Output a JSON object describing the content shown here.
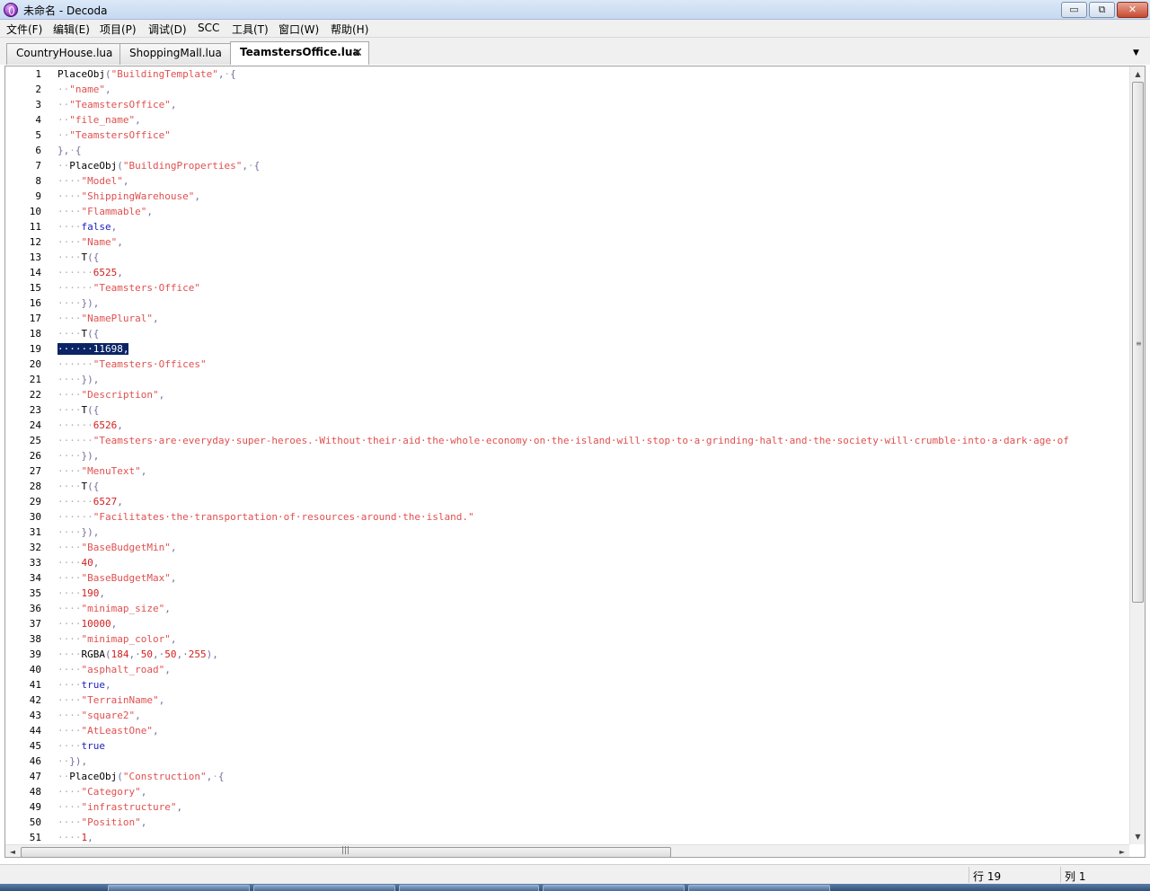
{
  "window": {
    "title": "未命名 - Decoda",
    "minimize_label": "▭",
    "maximize_label": "⧉",
    "close_label": "✕"
  },
  "menu": [
    {
      "label": "文件(F)"
    },
    {
      "label": "编辑(E)"
    },
    {
      "label": "项目(P)"
    },
    {
      "label": "调试(D)"
    },
    {
      "label": "SCC"
    },
    {
      "label": "工具(T)"
    },
    {
      "label": "窗口(W)"
    },
    {
      "label": "帮助(H)"
    }
  ],
  "tabs": [
    {
      "label": "CountryHouse.lua",
      "active": false
    },
    {
      "label": "ShoppingMall.lua",
      "active": false
    },
    {
      "label": "TeamstersOffice.lua",
      "active": true
    }
  ],
  "tab_close_label": "✕",
  "editor": {
    "selected_line": 19,
    "lines": [
      {
        "n": "1",
        "tokens": [
          [
            "PlaceObj",
            "d"
          ],
          [
            "(",
            "p"
          ],
          [
            "\"BuildingTemplate\"",
            "s"
          ],
          [
            ",",
            "p"
          ],
          [
            "·",
            "w"
          ],
          [
            "{",
            "p"
          ]
        ]
      },
      {
        "n": "2",
        "tokens": [
          [
            "··",
            "w"
          ],
          [
            "\"name\"",
            "s"
          ],
          [
            ",",
            "p"
          ]
        ]
      },
      {
        "n": "3",
        "tokens": [
          [
            "··",
            "w"
          ],
          [
            "\"TeamstersOffice\"",
            "s"
          ],
          [
            ",",
            "p"
          ]
        ]
      },
      {
        "n": "4",
        "tokens": [
          [
            "··",
            "w"
          ],
          [
            "\"file_name\"",
            "s"
          ],
          [
            ",",
            "p"
          ]
        ]
      },
      {
        "n": "5",
        "tokens": [
          [
            "··",
            "w"
          ],
          [
            "\"TeamstersOffice\"",
            "s"
          ]
        ]
      },
      {
        "n": "6",
        "tokens": [
          [
            "},",
            "p"
          ],
          [
            "·",
            "w"
          ],
          [
            "{",
            "p"
          ]
        ]
      },
      {
        "n": "7",
        "tokens": [
          [
            "··",
            "w"
          ],
          [
            "PlaceObj",
            "d"
          ],
          [
            "(",
            "p"
          ],
          [
            "\"BuildingProperties\"",
            "s"
          ],
          [
            ",",
            "p"
          ],
          [
            "·",
            "w"
          ],
          [
            "{",
            "p"
          ]
        ]
      },
      {
        "n": "8",
        "tokens": [
          [
            "····",
            "w"
          ],
          [
            "\"Model\"",
            "s"
          ],
          [
            ",",
            "p"
          ]
        ]
      },
      {
        "n": "9",
        "tokens": [
          [
            "····",
            "w"
          ],
          [
            "\"ShippingWarehouse\"",
            "s"
          ],
          [
            ",",
            "p"
          ]
        ]
      },
      {
        "n": "10",
        "tokens": [
          [
            "····",
            "w"
          ],
          [
            "\"Flammable\"",
            "s"
          ],
          [
            ",",
            "p"
          ]
        ]
      },
      {
        "n": "11",
        "tokens": [
          [
            "····",
            "w"
          ],
          [
            "false",
            "k"
          ],
          [
            ",",
            "p"
          ]
        ]
      },
      {
        "n": "12",
        "tokens": [
          [
            "····",
            "w"
          ],
          [
            "\"Name\"",
            "s"
          ],
          [
            ",",
            "p"
          ]
        ]
      },
      {
        "n": "13",
        "tokens": [
          [
            "····",
            "w"
          ],
          [
            "T",
            "d"
          ],
          [
            "({",
            "p"
          ]
        ]
      },
      {
        "n": "14",
        "tokens": [
          [
            "······",
            "w"
          ],
          [
            "6525",
            "n"
          ],
          [
            ",",
            "p"
          ]
        ]
      },
      {
        "n": "15",
        "tokens": [
          [
            "······",
            "w"
          ],
          [
            "\"Teamsters·Office\"",
            "s"
          ]
        ]
      },
      {
        "n": "16",
        "tokens": [
          [
            "····",
            "w"
          ],
          [
            "}),",
            "p"
          ]
        ]
      },
      {
        "n": "17",
        "tokens": [
          [
            "····",
            "w"
          ],
          [
            "\"NamePlural\"",
            "s"
          ],
          [
            ",",
            "p"
          ]
        ]
      },
      {
        "n": "18",
        "tokens": [
          [
            "····",
            "w"
          ],
          [
            "T",
            "d"
          ],
          [
            "({",
            "p"
          ]
        ]
      },
      {
        "n": "19",
        "tokens": [
          [
            "······11698,",
            "sel"
          ]
        ]
      },
      {
        "n": "20",
        "tokens": [
          [
            "······",
            "w"
          ],
          [
            "\"Teamsters·Offices\"",
            "s"
          ]
        ]
      },
      {
        "n": "21",
        "tokens": [
          [
            "····",
            "w"
          ],
          [
            "}),",
            "p"
          ]
        ]
      },
      {
        "n": "22",
        "tokens": [
          [
            "····",
            "w"
          ],
          [
            "\"Description\"",
            "s"
          ],
          [
            ",",
            "p"
          ]
        ]
      },
      {
        "n": "23",
        "tokens": [
          [
            "····",
            "w"
          ],
          [
            "T",
            "d"
          ],
          [
            "({",
            "p"
          ]
        ]
      },
      {
        "n": "24",
        "tokens": [
          [
            "······",
            "w"
          ],
          [
            "6526",
            "n"
          ],
          [
            ",",
            "p"
          ]
        ]
      },
      {
        "n": "25",
        "tokens": [
          [
            "······",
            "w"
          ],
          [
            "\"Teamsters·are·everyday·super-heroes.·Without·their·aid·the·whole·economy·on·the·island·will·stop·to·a·grinding·halt·and·the·society·will·crumble·into·a·dark·age·of",
            "s"
          ]
        ]
      },
      {
        "n": "26",
        "tokens": [
          [
            "····",
            "w"
          ],
          [
            "}),",
            "p"
          ]
        ]
      },
      {
        "n": "27",
        "tokens": [
          [
            "····",
            "w"
          ],
          [
            "\"MenuText\"",
            "s"
          ],
          [
            ",",
            "p"
          ]
        ]
      },
      {
        "n": "28",
        "tokens": [
          [
            "····",
            "w"
          ],
          [
            "T",
            "d"
          ],
          [
            "({",
            "p"
          ]
        ]
      },
      {
        "n": "29",
        "tokens": [
          [
            "······",
            "w"
          ],
          [
            "6527",
            "n"
          ],
          [
            ",",
            "p"
          ]
        ]
      },
      {
        "n": "30",
        "tokens": [
          [
            "······",
            "w"
          ],
          [
            "\"Facilitates·the·transportation·of·resources·around·the·island.\"",
            "s"
          ]
        ]
      },
      {
        "n": "31",
        "tokens": [
          [
            "····",
            "w"
          ],
          [
            "}),",
            "p"
          ]
        ]
      },
      {
        "n": "32",
        "tokens": [
          [
            "····",
            "w"
          ],
          [
            "\"BaseBudgetMin\"",
            "s"
          ],
          [
            ",",
            "p"
          ]
        ]
      },
      {
        "n": "33",
        "tokens": [
          [
            "····",
            "w"
          ],
          [
            "40",
            "n"
          ],
          [
            ",",
            "p"
          ]
        ]
      },
      {
        "n": "34",
        "tokens": [
          [
            "····",
            "w"
          ],
          [
            "\"BaseBudgetMax\"",
            "s"
          ],
          [
            ",",
            "p"
          ]
        ]
      },
      {
        "n": "35",
        "tokens": [
          [
            "····",
            "w"
          ],
          [
            "190",
            "n"
          ],
          [
            ",",
            "p"
          ]
        ]
      },
      {
        "n": "36",
        "tokens": [
          [
            "····",
            "w"
          ],
          [
            "\"minimap_size\"",
            "s"
          ],
          [
            ",",
            "p"
          ]
        ]
      },
      {
        "n": "37",
        "tokens": [
          [
            "····",
            "w"
          ],
          [
            "10000",
            "n"
          ],
          [
            ",",
            "p"
          ]
        ]
      },
      {
        "n": "38",
        "tokens": [
          [
            "····",
            "w"
          ],
          [
            "\"minimap_color\"",
            "s"
          ],
          [
            ",",
            "p"
          ]
        ]
      },
      {
        "n": "39",
        "tokens": [
          [
            "····",
            "w"
          ],
          [
            "RGBA",
            "d"
          ],
          [
            "(",
            "p"
          ],
          [
            "184",
            "n"
          ],
          [
            ",·",
            "p"
          ],
          [
            "50",
            "n"
          ],
          [
            ",·",
            "p"
          ],
          [
            "50",
            "n"
          ],
          [
            ",·",
            "p"
          ],
          [
            "255",
            "n"
          ],
          [
            "),",
            "p"
          ]
        ]
      },
      {
        "n": "40",
        "tokens": [
          [
            "····",
            "w"
          ],
          [
            "\"asphalt_road\"",
            "s"
          ],
          [
            ",",
            "p"
          ]
        ]
      },
      {
        "n": "41",
        "tokens": [
          [
            "····",
            "w"
          ],
          [
            "true",
            "k"
          ],
          [
            ",",
            "p"
          ]
        ]
      },
      {
        "n": "42",
        "tokens": [
          [
            "····",
            "w"
          ],
          [
            "\"TerrainName\"",
            "s"
          ],
          [
            ",",
            "p"
          ]
        ]
      },
      {
        "n": "43",
        "tokens": [
          [
            "····",
            "w"
          ],
          [
            "\"square2\"",
            "s"
          ],
          [
            ",",
            "p"
          ]
        ]
      },
      {
        "n": "44",
        "tokens": [
          [
            "····",
            "w"
          ],
          [
            "\"AtLeastOne\"",
            "s"
          ],
          [
            ",",
            "p"
          ]
        ]
      },
      {
        "n": "45",
        "tokens": [
          [
            "····",
            "w"
          ],
          [
            "true",
            "k"
          ]
        ]
      },
      {
        "n": "46",
        "tokens": [
          [
            "··",
            "w"
          ],
          [
            "}),",
            "p"
          ]
        ]
      },
      {
        "n": "47",
        "tokens": [
          [
            "··",
            "w"
          ],
          [
            "PlaceObj",
            "d"
          ],
          [
            "(",
            "p"
          ],
          [
            "\"Construction\"",
            "s"
          ],
          [
            ",",
            "p"
          ],
          [
            "·",
            "w"
          ],
          [
            "{",
            "p"
          ]
        ]
      },
      {
        "n": "48",
        "tokens": [
          [
            "····",
            "w"
          ],
          [
            "\"Category\"",
            "s"
          ],
          [
            ",",
            "p"
          ]
        ]
      },
      {
        "n": "49",
        "tokens": [
          [
            "····",
            "w"
          ],
          [
            "\"infrastructure\"",
            "s"
          ],
          [
            ",",
            "p"
          ]
        ]
      },
      {
        "n": "50",
        "tokens": [
          [
            "····",
            "w"
          ],
          [
            "\"Position\"",
            "s"
          ],
          [
            ",",
            "p"
          ]
        ]
      },
      {
        "n": "51",
        "tokens": [
          [
            "····",
            "w"
          ],
          [
            "1",
            "n"
          ],
          [
            ",",
            "p"
          ]
        ]
      }
    ]
  },
  "scrollbar": {
    "up_icon": "▲",
    "down_icon": "▼",
    "left_icon": "◄",
    "right_icon": "►",
    "grip": "≡",
    "hgrip": "|||"
  },
  "status": {
    "row": "行 19",
    "col": "列 1"
  },
  "colors": {
    "string": "#e05050",
    "number": "#d02020",
    "keyword": "#2020c0",
    "selection": "#0b2466"
  },
  "icons": {
    "app": "decoda-app-icon",
    "tab_dropdown": "▼"
  }
}
